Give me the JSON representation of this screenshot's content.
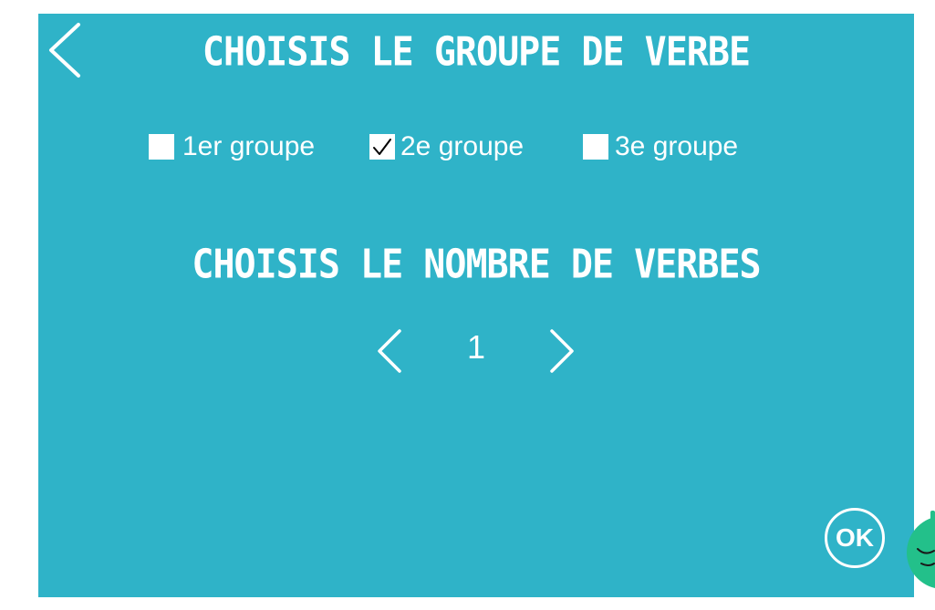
{
  "header": {
    "back_icon": "chevron-left-icon",
    "title": "CHOISIS LE GROUPE DE VERBE"
  },
  "groups": {
    "options": [
      {
        "label": "1er groupe",
        "checked": false
      },
      {
        "label": "2e groupe",
        "checked": true
      },
      {
        "label": "3e groupe",
        "checked": false
      }
    ]
  },
  "count": {
    "title": "CHOISIS LE NOMBRE DE VERBES",
    "value": "1",
    "prev_icon": "chevron-left-icon",
    "next_icon": "chevron-right-icon"
  },
  "actions": {
    "ok_label": "OK"
  },
  "colors": {
    "panel_background": "#2fb3c8",
    "foreground": "#ffffff",
    "mascot": "#23c08a"
  }
}
